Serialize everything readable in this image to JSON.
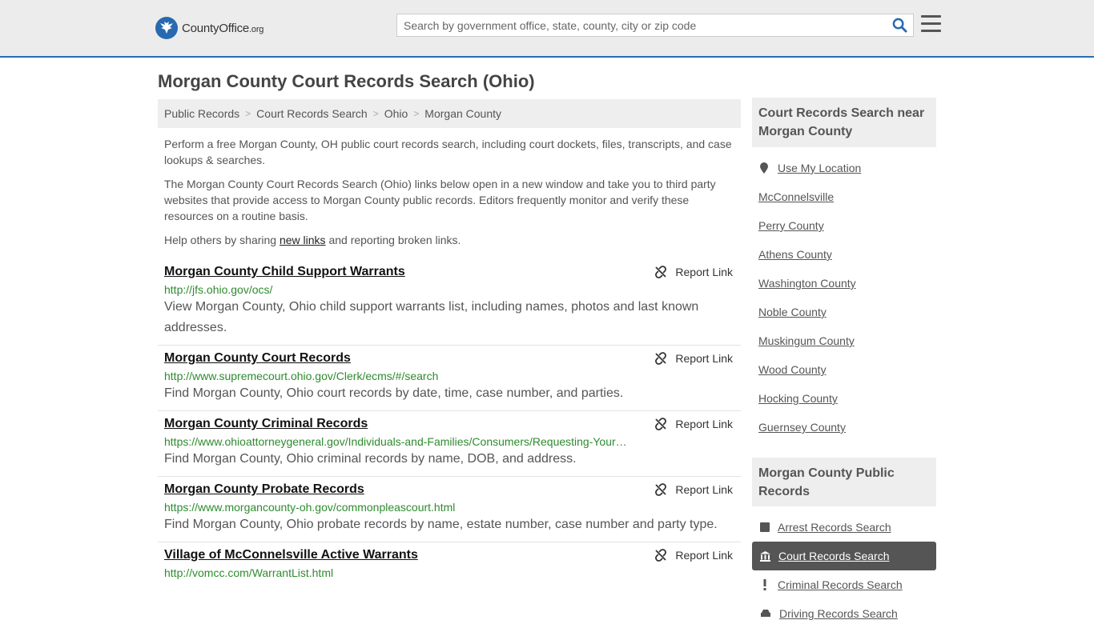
{
  "header": {
    "logo_main": "CountyOffice",
    "logo_tld": ".org",
    "search_placeholder": "Search by government office, state, county, city or zip code"
  },
  "page_title": "Morgan County Court Records Search (Ohio)",
  "breadcrumb": [
    "Public Records",
    "Court Records Search",
    "Ohio",
    "Morgan County"
  ],
  "intro": {
    "p1": "Perform a free Morgan County, OH public court records search, including court dockets, files, transcripts, and case lookups & searches.",
    "p2": "The Morgan County Court Records Search (Ohio) links below open in a new window and take you to third party websites that provide access to Morgan County public records. Editors frequently monitor and verify these resources on a routine basis.",
    "p3_before": "Help others by sharing ",
    "p3_link": "new links",
    "p3_after": " and reporting broken links."
  },
  "report_label": "Report Link",
  "items": [
    {
      "title": "Morgan County Child Support Warrants",
      "url": "http://jfs.ohio.gov/ocs/",
      "desc": "View Morgan County, Ohio child support warrants list, including names, photos and last known addresses."
    },
    {
      "title": "Morgan County Court Records",
      "url": "http://www.supremecourt.ohio.gov/Clerk/ecms/#/search",
      "desc": "Find Morgan County, Ohio court records by date, time, case number, and parties."
    },
    {
      "title": "Morgan County Criminal Records",
      "url": "https://www.ohioattorneygeneral.gov/Individuals-and-Families/Consumers/Requesting-Your…",
      "desc": "Find Morgan County, Ohio criminal records by name, DOB, and address."
    },
    {
      "title": "Morgan County Probate Records",
      "url": "https://www.morgancounty-oh.gov/commonpleascourt.html",
      "desc": "Find Morgan County, Ohio probate records by name, estate number, case number and party type."
    },
    {
      "title": "Village of McConnelsville Active Warrants",
      "url": "http://vomcc.com/WarrantList.html",
      "desc": ""
    }
  ],
  "sidebar": {
    "nearby_heading": "Court Records Search near Morgan County",
    "use_location": "Use My Location",
    "nearby": [
      "McConnelsville",
      "Perry County",
      "Athens County",
      "Washington County",
      "Noble County",
      "Muskingum County",
      "Wood County",
      "Hocking County",
      "Guernsey County"
    ],
    "public_heading": "Morgan County Public Records",
    "public_records": [
      {
        "label": "Arrest Records Search",
        "icon": "square-icon"
      },
      {
        "label": "Court Records Search",
        "icon": "courthouse-icon"
      },
      {
        "label": "Criminal Records Search",
        "icon": "exclamation-icon"
      },
      {
        "label": "Driving Records Search",
        "icon": "car-icon"
      }
    ]
  },
  "colors": {
    "brand_blue": "#2869b0",
    "url_green": "#2e8b2e",
    "active_bg": "#555555"
  }
}
